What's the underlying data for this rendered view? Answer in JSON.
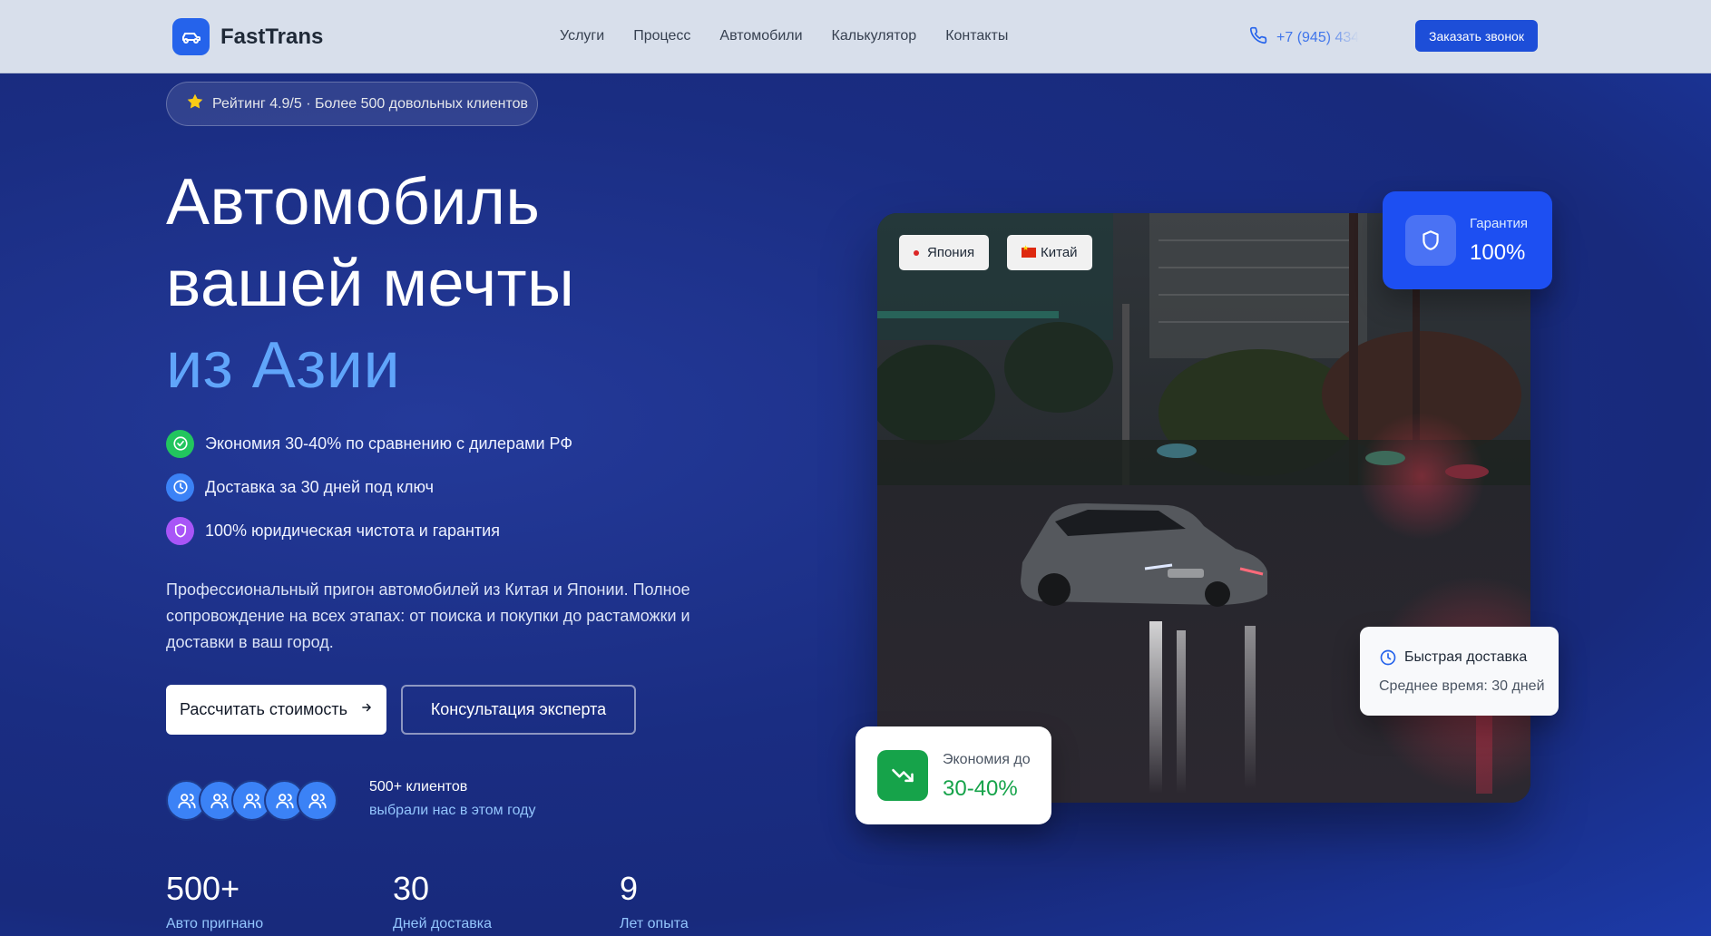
{
  "header": {
    "logo_text": "FastTrans",
    "nav": [
      "Услуги",
      "Процесс",
      "Автомобили",
      "Калькулятор",
      "Контакты"
    ],
    "phone": "+7 (945) 434",
    "call_button": "Заказать звонок"
  },
  "hero": {
    "rating": "Рейтинг 4.9/5 · Более 500 довольных клиентов",
    "title_line1": "Автомобиль",
    "title_line2": "вашей мечты",
    "title_line3": "из Азии",
    "features": [
      {
        "text": "Экономия 30-40% по сравнению с дилерами РФ",
        "icon": "check-circle-icon",
        "color": "#22c55e"
      },
      {
        "text": "Доставка за 30 дней под ключ",
        "icon": "clock-icon",
        "color": "#3b82f6"
      },
      {
        "text": "100% юридическая чистота и гарантия",
        "icon": "shield-icon",
        "color": "#a855f7"
      }
    ],
    "description": "Профессиональный пригон автомобилей из Китая и Японии. Полное сопровождение на всех этапах: от поиска и покупки до растаможки и доставки в ваш город.",
    "primary_button": "Рассчитать стоимость",
    "secondary_button": "Консультация эксперта",
    "clients_count": "500+ клиентов",
    "clients_sub": "выбрали нас в этом году",
    "stats": [
      {
        "value": "500+",
        "label": "Авто пригнано"
      },
      {
        "value": "30",
        "label": "Дней доставка"
      },
      {
        "value": "9",
        "label": "Лет опыта"
      }
    ]
  },
  "media": {
    "tag_japan": "Япония",
    "tag_china": "Китай",
    "guarantee_label": "Гарантия",
    "guarantee_value": "100%",
    "delivery_title": "Быстрая доставка",
    "delivery_sub": "Среднее время: 30 дней",
    "savings_label": "Экономия до",
    "savings_value": "30-40%"
  },
  "colors": {
    "accent": "#2563eb",
    "title_accent": "#60a5fa",
    "success": "#16a34a"
  }
}
